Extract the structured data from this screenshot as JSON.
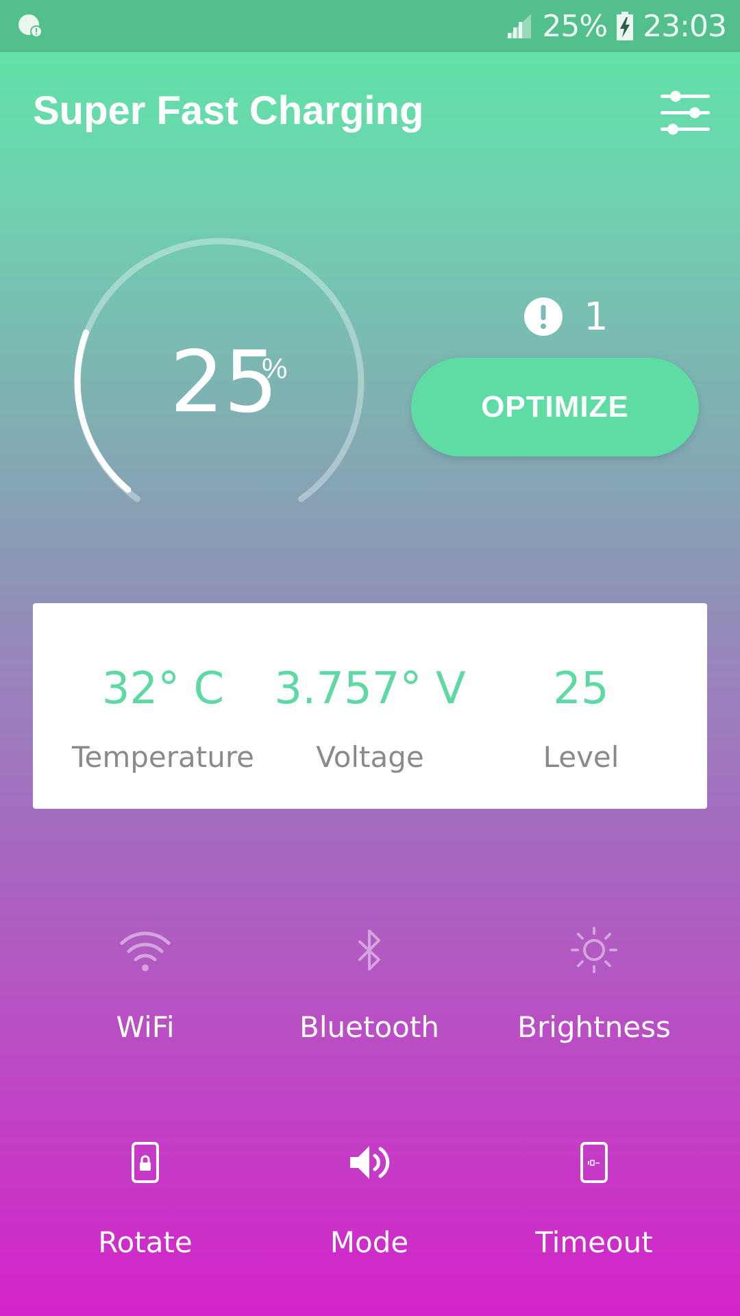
{
  "status_bar": {
    "battery_percent": "25%",
    "time": "23:03"
  },
  "header": {
    "title": "Super Fast Charging",
    "settings_icon": "sliders-icon"
  },
  "gauge": {
    "value": "25",
    "unit": "%",
    "level_fraction": 0.25
  },
  "alert": {
    "count": "1",
    "icon": "exclamation-circle-icon"
  },
  "optimize_label": "OPTIMIZE",
  "stats": [
    {
      "value": "32° C",
      "label": "Temperature"
    },
    {
      "value": "3.757° V",
      "label": "Voltage"
    },
    {
      "value": "25",
      "label": "Level"
    }
  ],
  "toggles": [
    {
      "label": "WiFi",
      "icon": "wifi-icon"
    },
    {
      "label": "Bluetooth",
      "icon": "bluetooth-icon"
    },
    {
      "label": "Brightness",
      "icon": "brightness-icon"
    },
    {
      "label": "Rotate",
      "icon": "rotate-lock-icon"
    },
    {
      "label": "Mode",
      "icon": "speaker-icon"
    },
    {
      "label": "Timeout",
      "icon": "screen-timeout-icon"
    }
  ],
  "colors": {
    "accent": "#5fdca3",
    "status_bar": "#53bf8d",
    "stat_value": "#5ed9a3"
  }
}
